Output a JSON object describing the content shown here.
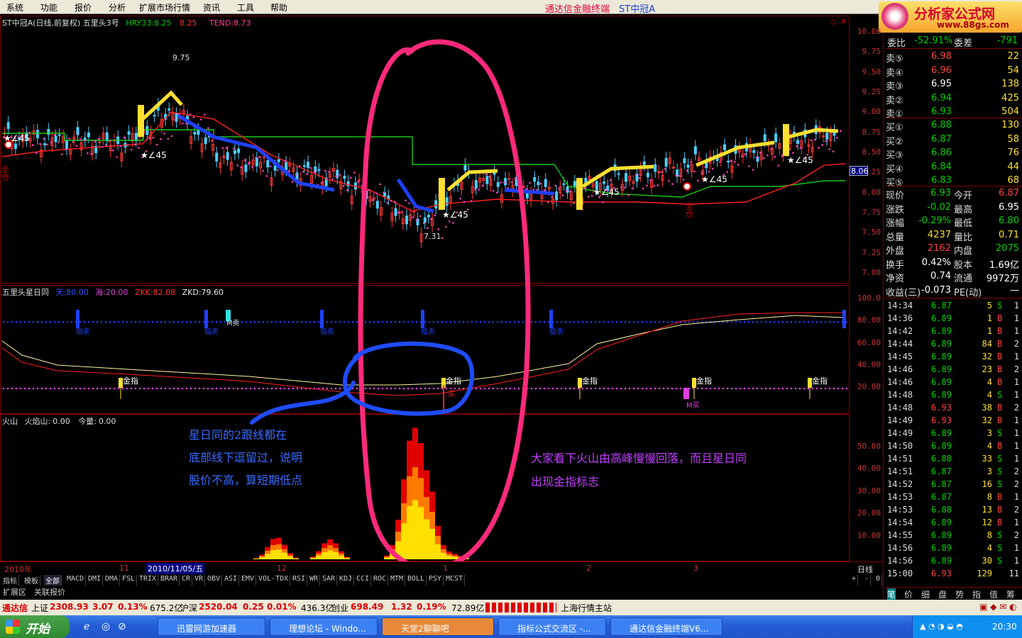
{
  "menu": [
    "系统",
    "功能",
    "报价",
    "分析",
    "扩展市场行情",
    "资讯",
    "工具",
    "帮助"
  ],
  "title": {
    "app": "通达信金融终端",
    "stock": "ST中冠A"
  },
  "logo": {
    "name": "分析家公式网",
    "url": "www.88gs.com"
  },
  "main_chart": {
    "head_name": "ST中冠A(日线,前复权) 五里头3号",
    "hry_label": "HRY33:",
    "hry_value": "8.25",
    "hry_value2": "8.25",
    "tend_label": "TEND:",
    "tend_value": "8.73",
    "y_ticks": [
      "10.00",
      "9.75",
      "9.50",
      "9.25",
      "9.00",
      "8.75",
      "8.50",
      "8.25",
      "8.00",
      "7.75",
      "7.50",
      "7.25",
      "7.00"
    ],
    "current_price_label": "8.06",
    "high_label": "9.75",
    "low_label": "7.31",
    "star_labels": [
      "★∠45",
      "★∠45",
      "★∠45",
      "★∠45",
      "★∠45",
      "★∠45"
    ],
    "full_pos_label": "全仓"
  },
  "sub_chart": {
    "head_name": "五里头星日同",
    "tian_label": "天:",
    "tian_value": "80.00",
    "hai_label": "海:",
    "hai_value": "20.00",
    "zkk_label": "ZKK:",
    "zkk_value": "82.08",
    "zkd_label": "ZKD:",
    "zkd_value": "79.60",
    "y_ticks": [
      "100.0",
      "80.00",
      "60.00",
      "40.00",
      "20.00"
    ],
    "sell_label": "指卖",
    "msell_label": "M卖",
    "gold_label": "金指",
    "mbuy_label": "M买",
    "buy_label": "买"
  },
  "volc_chart": {
    "head_name": "火山",
    "fire_label": "火焰山:",
    "fire_value": "0.00",
    "vol_label": "今量:",
    "vol_value": "0.00",
    "y_ticks": [
      "50.00",
      "40.00",
      "30.00",
      "20.00",
      "10.00"
    ]
  },
  "annotations": {
    "left_note": [
      "星日同的2跟线都在",
      "底部线下逗留过，说明",
      "股价不高，算短期低点"
    ],
    "right_note": [
      "大家看下火山由高峰慢慢回落，而且星日同",
      "出现金指标志"
    ]
  },
  "xaxis": {
    "labels": [
      "2010年",
      "11",
      "2010/11/05/五",
      "12",
      "1",
      "2",
      "3"
    ],
    "period": "日线"
  },
  "tabs": [
    "指标",
    "模板",
    "全部",
    "MACD",
    "DMI",
    "DMA",
    "FSL",
    "TRIX",
    "BRAR",
    "CR",
    "VR",
    "OBV",
    "ASI",
    "EMV",
    "VOL-TDX",
    "RSI",
    "WR",
    "SAR",
    "KDJ",
    "CCI",
    "ROC",
    "MTM",
    "BOLL",
    "PSY",
    "MCST"
  ],
  "tabs2": [
    "扩展区",
    "关联报价"
  ],
  "tab_controls": [
    "+",
    "-",
    "0"
  ],
  "quote": {
    "ratio_label": "委比",
    "ratio": "-52.91%",
    "diff_label": "委差",
    "diff": "-791",
    "asks": [
      {
        "l": "卖⑤",
        "p": "6.98",
        "v": "22"
      },
      {
        "l": "卖④",
        "p": "6.96",
        "v": "54"
      },
      {
        "l": "卖③",
        "p": "6.95",
        "v": "138"
      },
      {
        "l": "卖②",
        "p": "6.94",
        "v": "425"
      },
      {
        "l": "卖①",
        "p": "6.93",
        "v": "504"
      }
    ],
    "bids": [
      {
        "l": "买①",
        "p": "6.88",
        "v": "130"
      },
      {
        "l": "买②",
        "p": "6.87",
        "v": "58"
      },
      {
        "l": "买③",
        "p": "6.86",
        "v": "76"
      },
      {
        "l": "买④",
        "p": "6.84",
        "v": "44"
      },
      {
        "l": "买⑤",
        "p": "6.83",
        "v": "68"
      }
    ],
    "stats": [
      {
        "a": "现价",
        "av": "6.93",
        "b": "今开",
        "bv": "6.87"
      },
      {
        "a": "涨跌",
        "av": "-0.02",
        "b": "最高",
        "bv": "6.95"
      },
      {
        "a": "涨幅",
        "av": "-0.29%",
        "b": "最低",
        "bv": "6.80"
      },
      {
        "a": "总量",
        "av": "4237",
        "b": "量比",
        "bv": "0.71"
      },
      {
        "a": "外盘",
        "av": "2162",
        "b": "内盘",
        "bv": "2075"
      },
      {
        "a": "换手",
        "av": "0.42%",
        "b": "股本",
        "bv": "1.69亿"
      },
      {
        "a": "净资",
        "av": "0.74",
        "b": "流通",
        "bv": "9972万"
      },
      {
        "a": "收益(三)",
        "av": "-0.073",
        "b": "PE(动)",
        "bv": "—"
      }
    ],
    "ticks": [
      {
        "t": "14:34",
        "p": "6.87",
        "v": "5",
        "s": "S",
        "n": "1"
      },
      {
        "t": "14:36",
        "p": "6.89",
        "v": "1",
        "s": "B",
        "n": "1"
      },
      {
        "t": "14:42",
        "p": "6.89",
        "v": "1",
        "s": "B",
        "n": "1"
      },
      {
        "t": "14:44",
        "p": "6.89",
        "v": "84",
        "s": "B",
        "n": "2"
      },
      {
        "t": "14:45",
        "p": "6.89",
        "v": "32",
        "s": "B",
        "n": "1"
      },
      {
        "t": "14:46",
        "p": "6.89",
        "v": "23",
        "s": "B",
        "n": "2"
      },
      {
        "t": "14:46",
        "p": "6.89",
        "v": "4",
        "s": "B",
        "n": "1"
      },
      {
        "t": "14:48",
        "p": "6.89",
        "v": "4",
        "s": "S",
        "n": "1"
      },
      {
        "t": "14:48",
        "p": "6.93",
        "v": "38",
        "s": "B",
        "n": "2"
      },
      {
        "t": "14:49",
        "p": "6.93",
        "v": "32",
        "s": "B",
        "n": "1"
      },
      {
        "t": "14:49",
        "p": "6.89",
        "v": "3",
        "s": "S",
        "n": "1"
      },
      {
        "t": "14:50",
        "p": "6.89",
        "v": "4",
        "s": "B",
        "n": "1"
      },
      {
        "t": "14:51",
        "p": "6.88",
        "v": "33",
        "s": "S",
        "n": "1"
      },
      {
        "t": "14:51",
        "p": "6.87",
        "v": "3",
        "s": "S",
        "n": "2"
      },
      {
        "t": "14:52",
        "p": "6.87",
        "v": "16",
        "s": "S",
        "n": "2"
      },
      {
        "t": "14:53",
        "p": "6.87",
        "v": "8",
        "s": "B",
        "n": "1"
      },
      {
        "t": "14:53",
        "p": "6.88",
        "v": "13",
        "s": "B",
        "n": "2"
      },
      {
        "t": "14:54",
        "p": "6.89",
        "v": "12",
        "s": "B",
        "n": "1"
      },
      {
        "t": "14:55",
        "p": "6.89",
        "v": "8",
        "s": "S",
        "n": "2"
      },
      {
        "t": "14:56",
        "p": "6.89",
        "v": "4",
        "s": "S",
        "n": "1"
      },
      {
        "t": "14:56",
        "p": "6.89",
        "v": "30",
        "s": "S",
        "n": "1"
      },
      {
        "t": "15:00",
        "p": "6.93",
        "v": "129",
        "s": "",
        "n": "11"
      }
    ],
    "bottom_tabs": [
      "笔",
      "价",
      "细",
      "盘",
      "势",
      "指",
      "值",
      "筹"
    ]
  },
  "status": {
    "brand": "通达信",
    "sh_label": "上证",
    "sh_val": "2308.93",
    "sh_chg": "3.07",
    "sh_pct": "0.13%",
    "sh_amt": "675.2亿",
    "sz_label": "沪深",
    "sz_val": "2520.04",
    "sz_chg": "0.25",
    "sz_pct": "0.01%",
    "sz_amt": "436.3亿",
    "cy_label": "创业",
    "cy_val": "698.49",
    "cy_chg": "1.32",
    "cy_pct": "0.19%",
    "cy_amt": "72.89亿",
    "station": "上海行情主站"
  },
  "taskbar": {
    "start": "开始",
    "items": [
      "迅雷网游加速器",
      "理想论坛 - Windo...",
      "天堂2聊聊吧",
      "指标公式交流区 -...",
      "通达信金融终端V6..."
    ],
    "clock": "20:30"
  }
}
